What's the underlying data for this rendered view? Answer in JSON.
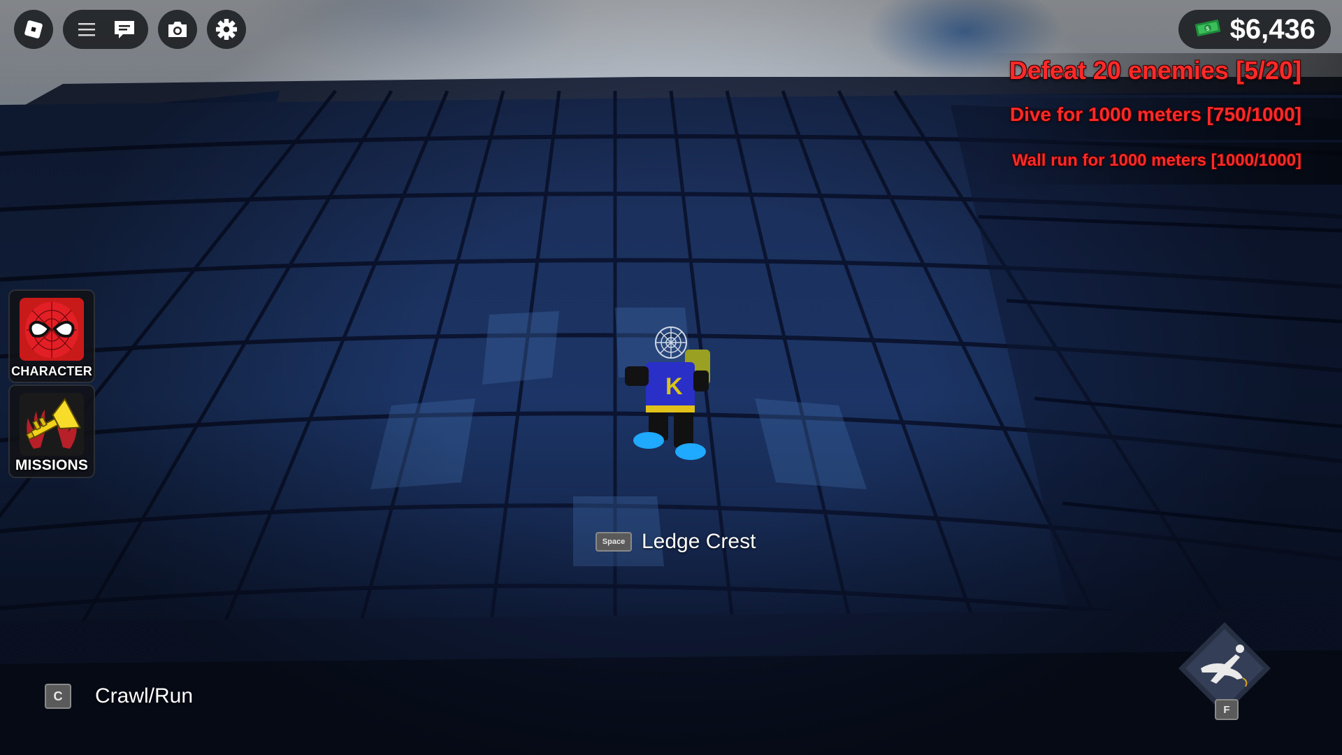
{
  "topbar": {
    "roblox_icon": "roblox-logo-icon",
    "menu_icon": "hamburger-icon",
    "chat_icon": "chat-icon",
    "screenshot_icon": "camera-icon",
    "settings_icon": "gear-icon"
  },
  "currency": {
    "amount": "$6,436",
    "icon": "cash-icon",
    "color": "#ffffff"
  },
  "missions": [
    {
      "text": "Defeat 20 enemies [5/20]"
    },
    {
      "text": "Dive for 1000 meters [750/1000]"
    },
    {
      "text": "Wall run for 1000 meters [1000/1000]"
    }
  ],
  "mission_color": "#ff2a2a",
  "side_buttons": {
    "character": {
      "label": "CHARACTER",
      "icon": "spiderman-mask-icon"
    },
    "missions": {
      "label": "MISSIONS",
      "icon": "trumpet-icon"
    }
  },
  "prompt": {
    "key": "Space",
    "action": "Ledge Crest"
  },
  "crawl": {
    "key": "C",
    "action": "Crawl/Run"
  },
  "dive": {
    "key": "F",
    "icon": "dive-pose-icon"
  }
}
